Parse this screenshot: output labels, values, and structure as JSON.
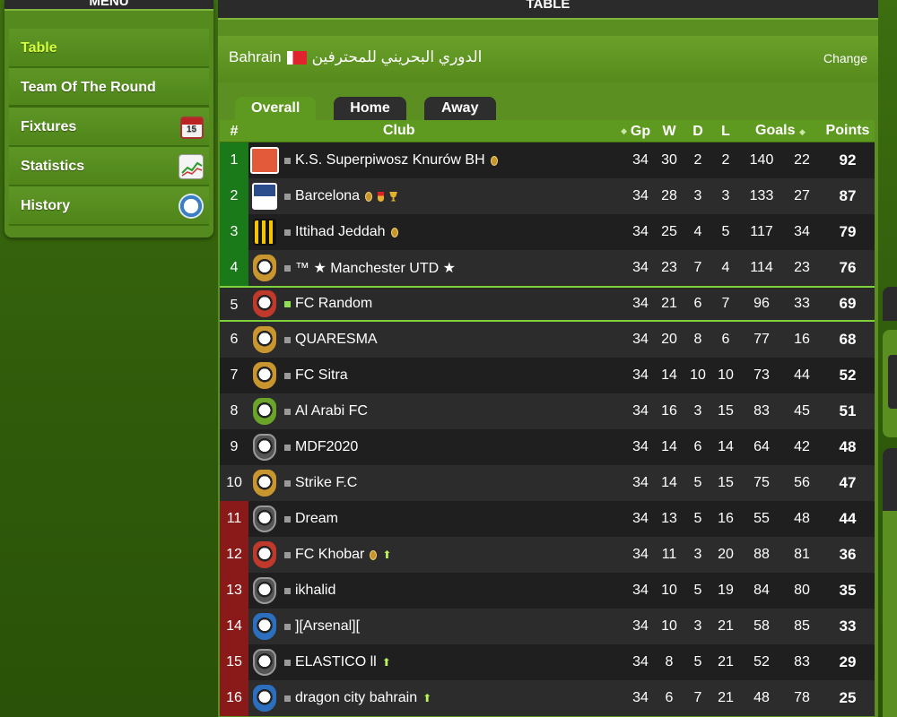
{
  "menu": {
    "title": "MENU",
    "items": [
      {
        "label": "Table",
        "active": true,
        "icon": null
      },
      {
        "label": "Team Of The Round",
        "active": false,
        "icon": null
      },
      {
        "label": "Fixtures",
        "active": false,
        "icon": "calendar-icon",
        "icon_text": "15"
      },
      {
        "label": "Statistics",
        "active": false,
        "icon": "chart-icon"
      },
      {
        "label": "History",
        "active": false,
        "icon": "clock-icon"
      }
    ]
  },
  "panel": {
    "title": "TABLE",
    "league": "Bahrain",
    "league_arabic": "الدوري البحريني للمحترفين",
    "change_label": "Change",
    "tabs": [
      "Overall",
      "Home",
      "Away"
    ]
  },
  "table": {
    "headers": {
      "pos": "#",
      "club": "Club",
      "gp": "Gp",
      "w": "W",
      "d": "D",
      "l": "L",
      "goals": "Goals",
      "points": "Points"
    },
    "rows": [
      {
        "pos": "1",
        "club": "K.S. Superpiwosz Knurów BH",
        "gp": "34",
        "w": "30",
        "d": "2",
        "l": "2",
        "gf": "140",
        "ga": "22",
        "pts": "92"
      },
      {
        "pos": "2",
        "club": "Barcelona",
        "gp": "34",
        "w": "28",
        "d": "3",
        "l": "3",
        "gf": "133",
        "ga": "27",
        "pts": "87"
      },
      {
        "pos": "3",
        "club": "Ittihad Jeddah",
        "gp": "34",
        "w": "25",
        "d": "4",
        "l": "5",
        "gf": "117",
        "ga": "34",
        "pts": "79"
      },
      {
        "pos": "4",
        "club": "™ ★ Manchester UTD ★",
        "gp": "34",
        "w": "23",
        "d": "7",
        "l": "4",
        "gf": "114",
        "ga": "23",
        "pts": "76"
      },
      {
        "pos": "5",
        "club": "FC Random",
        "gp": "34",
        "w": "21",
        "d": "6",
        "l": "7",
        "gf": "96",
        "ga": "33",
        "pts": "69"
      },
      {
        "pos": "6",
        "club": "QUARESMA",
        "gp": "34",
        "w": "20",
        "d": "8",
        "l": "6",
        "gf": "77",
        "ga": "16",
        "pts": "68"
      },
      {
        "pos": "7",
        "club": "FC Sitra",
        "gp": "34",
        "w": "14",
        "d": "10",
        "l": "10",
        "gf": "73",
        "ga": "44",
        "pts": "52"
      },
      {
        "pos": "8",
        "club": "Al Arabi FC",
        "gp": "34",
        "w": "16",
        "d": "3",
        "l": "15",
        "gf": "83",
        "ga": "45",
        "pts": "51"
      },
      {
        "pos": "9",
        "club": "MDF2020",
        "gp": "34",
        "w": "14",
        "d": "6",
        "l": "14",
        "gf": "64",
        "ga": "42",
        "pts": "48"
      },
      {
        "pos": "10",
        "club": "Strike F.C",
        "gp": "34",
        "w": "14",
        "d": "5",
        "l": "15",
        "gf": "75",
        "ga": "56",
        "pts": "47"
      },
      {
        "pos": "11",
        "club": "Dream",
        "gp": "34",
        "w": "13",
        "d": "5",
        "l": "16",
        "gf": "55",
        "ga": "48",
        "pts": "44"
      },
      {
        "pos": "12",
        "club": "FC Khobar",
        "gp": "34",
        "w": "11",
        "d": "3",
        "l": "20",
        "gf": "88",
        "ga": "81",
        "pts": "36"
      },
      {
        "pos": "13",
        "club": "ikhalid",
        "gp": "34",
        "w": "10",
        "d": "5",
        "l": "19",
        "gf": "84",
        "ga": "80",
        "pts": "35"
      },
      {
        "pos": "14",
        "club": "][Arsenal][",
        "gp": "34",
        "w": "10",
        "d": "3",
        "l": "21",
        "gf": "58",
        "ga": "85",
        "pts": "33"
      },
      {
        "pos": "15",
        "club": "ELASTICO ll",
        "gp": "34",
        "w": "8",
        "d": "5",
        "l": "21",
        "gf": "52",
        "ga": "83",
        "pts": "29"
      },
      {
        "pos": "16",
        "club": "dragon city bahrain",
        "gp": "34",
        "w": "6",
        "d": "7",
        "l": "21",
        "gf": "48",
        "ga": "78",
        "pts": "25"
      }
    ]
  },
  "colors": {
    "promotion": "#1a7a1a",
    "relegation": "#8a1a1a",
    "active_menu": "#d4ff3a",
    "highlight_border": "#7fd13b"
  }
}
